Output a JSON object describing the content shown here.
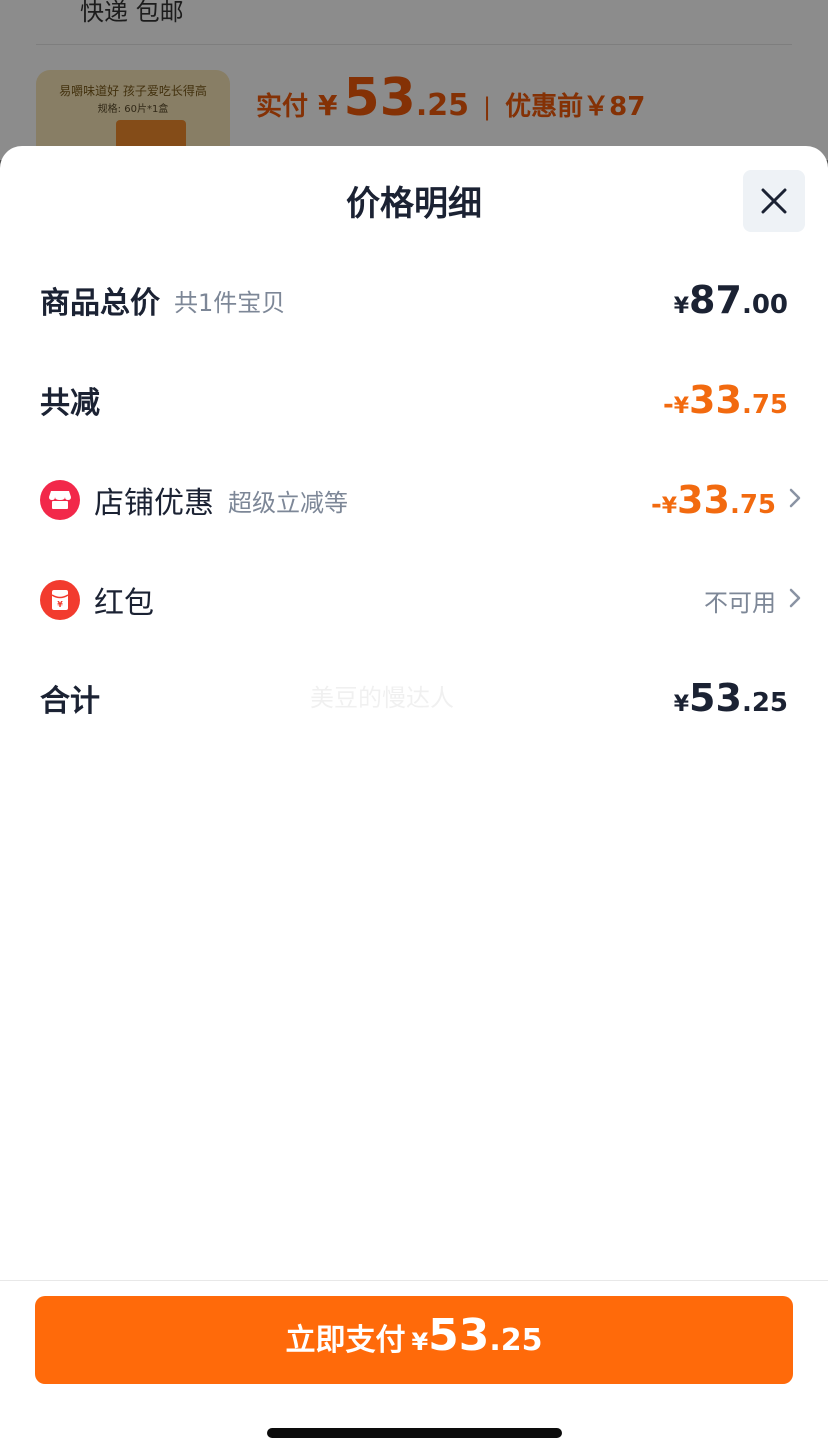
{
  "background_page": {
    "shipping_text": "快递 包邮",
    "product_tagline": "易嚼味道好 孩子爱吃长得高",
    "product_spec": "规格: 60片*1盒",
    "paid_label": "实付",
    "paid_currency": "¥",
    "paid_int": "53",
    "paid_dec": ".25",
    "separator": "|",
    "before_discount": "优惠前￥87"
  },
  "sheet": {
    "title": "价格明细",
    "close_icon": "close-icon"
  },
  "rows": {
    "subtotal": {
      "label": "商品总价",
      "sub": "共1件宝贝",
      "currency": "¥",
      "int": "87",
      "dec": ".00"
    },
    "total_discount": {
      "label": "共减",
      "sign": "-",
      "currency": "¥",
      "int": "33",
      "dec": ".75"
    },
    "store_discount": {
      "icon": "store-icon",
      "label": "店铺优惠",
      "sub": "超级立减等",
      "sign": "-",
      "currency": "¥",
      "int": "33",
      "dec": ".75"
    },
    "red_packet": {
      "icon": "red-packet-icon",
      "label": "红包",
      "status": "不可用"
    },
    "total": {
      "label": "合计",
      "currency": "¥",
      "int": "53",
      "dec": ".25"
    }
  },
  "watermark": "美豆的慢达人",
  "pay_button": {
    "label": "立即支付",
    "currency": "¥",
    "int": "53",
    "dec": ".25"
  },
  "colors": {
    "accent_orange": "#ff6a0a",
    "price_orange": "#f26a0f",
    "store_icon_red": "#f2284a",
    "red_packet_red": "#f23b2e",
    "text_dark": "#1b2233",
    "text_muted": "#7d8797"
  }
}
